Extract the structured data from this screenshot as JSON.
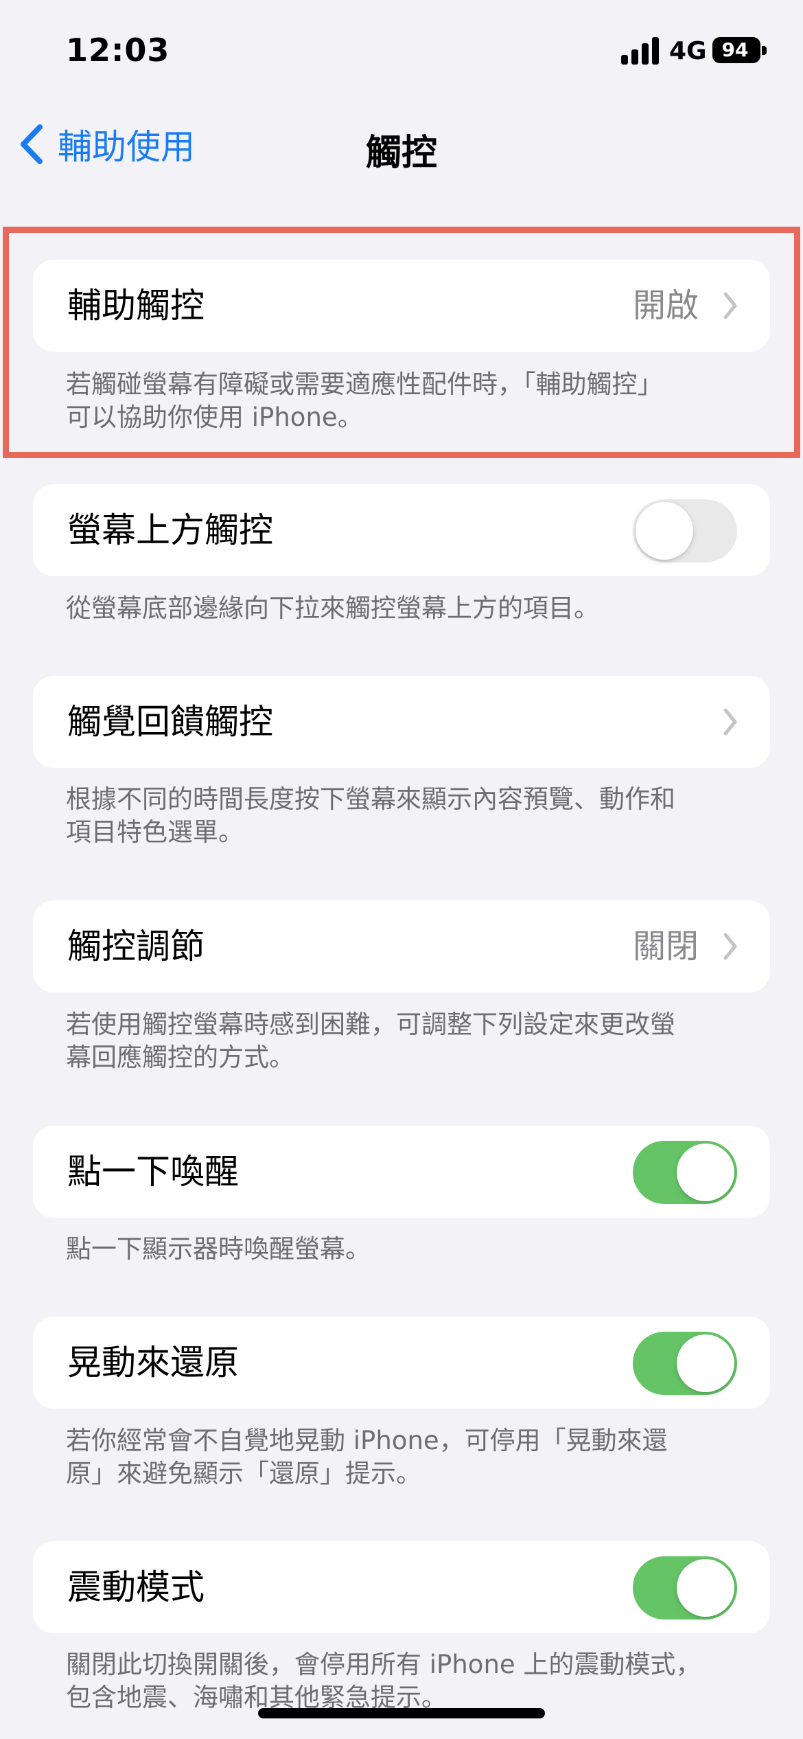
{
  "status_bar": {
    "time": "12:03",
    "network": "4G",
    "battery": "94"
  },
  "nav": {
    "back_label": "輔助使用",
    "title": "觸控"
  },
  "colors": {
    "accent": "#1a7cf5",
    "toggle_on": "#65c466",
    "toggle_off": "#e9e9ea",
    "highlight": "#e8685a",
    "background": "#f2f2f7",
    "secondary_text": "#6d6d72"
  },
  "settings": [
    {
      "label": "輔助觸控",
      "value": "開啟",
      "control": "chevron",
      "footer_lines": [
        "若觸碰螢幕有障礙或需要適應性配件時，「輔助觸控」",
        "可以協助你使用 iPhone。"
      ]
    },
    {
      "label": "螢幕上方觸控",
      "control": "toggle",
      "toggle": "off",
      "footer_lines": [
        "從螢幕底部邊緣向下拉來觸控螢幕上方的項目。"
      ]
    },
    {
      "label": "觸覺回饋觸控",
      "control": "chevron",
      "footer_lines": [
        "根據不同的時間長度按下螢幕來顯示內容預覽、動作和",
        "項目特色選單。"
      ]
    },
    {
      "label": "觸控調節",
      "value": "關閉",
      "control": "chevron",
      "footer_lines": [
        "若使用觸控螢幕時感到困難，可調整下列設定來更改螢",
        "幕回應觸控的方式。"
      ]
    },
    {
      "label": "點一下喚醒",
      "control": "toggle",
      "toggle": "on",
      "footer_lines": [
        "點一下顯示器時喚醒螢幕。"
      ]
    },
    {
      "label": "晃動來還原",
      "control": "toggle",
      "toggle": "on",
      "footer_lines": [
        "若你經常會不自覺地晃動 iPhone，可停用「晃動來還",
        "原」來避免顯示「還原」提示。"
      ]
    },
    {
      "label": "震動模式",
      "control": "toggle",
      "toggle": "on",
      "footer_lines": [
        "關閉此切換開關後，會停用所有 iPhone 上的震動模式，",
        "包含地震、海嘯和其他緊急提示。"
      ]
    }
  ]
}
